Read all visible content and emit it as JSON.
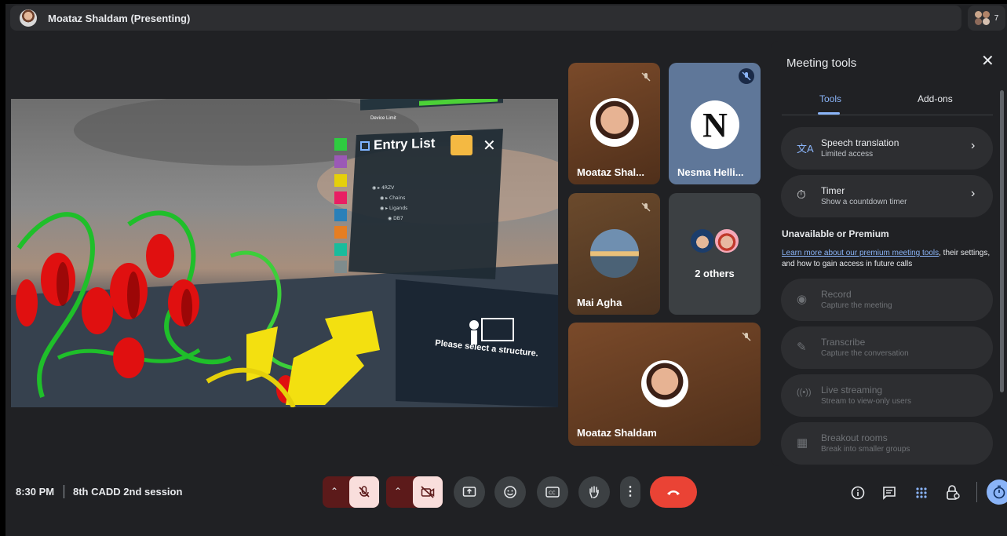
{
  "presenter": {
    "name": "Moataz Shaldam (Presenting)"
  },
  "participants": {
    "count": "7"
  },
  "shared_screen": {
    "panel_title": "Entry List",
    "device_label": "Device Limit",
    "hint": "Please select a structure."
  },
  "tiles": [
    {
      "name": "Moataz Shal...",
      "muted": true
    },
    {
      "name": "Nesma Helli...",
      "muted": true,
      "initial": "N"
    },
    {
      "name": "Mai Agha",
      "muted": true
    },
    {
      "name": "2 others"
    },
    {
      "name": "Moataz Shaldam",
      "muted": true
    }
  ],
  "tools_panel": {
    "title": "Meeting tools",
    "tabs": [
      "Tools",
      "Add-ons"
    ],
    "active_tab": "Tools",
    "items": [
      {
        "label": "Speech translation",
        "sub": "Limited access",
        "icon": "translate-icon"
      },
      {
        "label": "Timer",
        "sub": "Show a countdown timer",
        "icon": "timer-icon"
      }
    ],
    "section_title": "Unavailable or Premium",
    "learn_more_link": "Learn more about our premium meeting tools",
    "learn_more_rest": ", their settings, and how to gain access in future calls",
    "premium_items": [
      {
        "label": "Record",
        "sub": "Capture the meeting",
        "icon": "record-icon"
      },
      {
        "label": "Transcribe",
        "sub": "Capture the conversation",
        "icon": "transcribe-icon"
      },
      {
        "label": "Live streaming",
        "sub": "Stream to view-only users",
        "icon": "live-stream-icon"
      },
      {
        "label": "Breakout rooms",
        "sub": "Break into smaller groups",
        "icon": "breakout-icon"
      }
    ]
  },
  "bottom_bar": {
    "time": "8:30 PM",
    "meeting_name": "8th CADD 2nd session"
  },
  "colors": {
    "accent": "#8ab4f8",
    "end_call": "#ea4335",
    "muted_bg": "#f9dedc",
    "panel_bg": "#202124"
  }
}
